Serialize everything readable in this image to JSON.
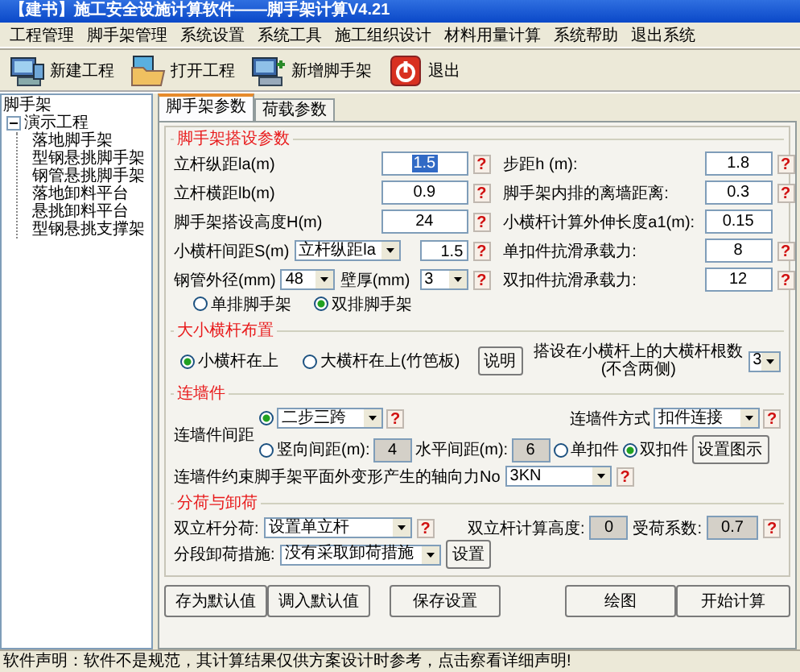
{
  "window": {
    "title": "【建书】施工安全设施计算软件——脚手架计算V4.21"
  },
  "menu": [
    "工程管理",
    "脚手架管理",
    "系统设置",
    "系统工具",
    "施工组织设计",
    "材料用量计算",
    "系统帮助",
    "退出系统"
  ],
  "toolbar": [
    {
      "label": "新建工程",
      "kind": "new"
    },
    {
      "label": "打开工程",
      "kind": "open"
    },
    {
      "label": "新增脚手架",
      "kind": "add"
    },
    {
      "label": "退出",
      "kind": "exit"
    }
  ],
  "tree": {
    "label": "脚手架",
    "children": [
      {
        "label": "演示工程",
        "expanded": true,
        "children": [
          {
            "label": "落地脚手架"
          },
          {
            "label": "型钢悬挑脚手架"
          },
          {
            "label": "钢管悬挑脚手架"
          },
          {
            "label": "落地卸料平台"
          },
          {
            "label": "悬挑卸料平台"
          },
          {
            "label": "型钢悬挑支撑架"
          }
        ]
      }
    ]
  },
  "tabs": [
    {
      "label": "脚手架参数",
      "selected": true
    },
    {
      "label": "荷载参数",
      "selected": false
    }
  ],
  "params": {
    "title": "脚手架搭设参数",
    "left": [
      {
        "label": "立杆纵距la(m)",
        "value": "1.5",
        "focused": true,
        "help": "?"
      },
      {
        "label": "立杆横距lb(m)",
        "value": "0.9",
        "focused": false,
        "help": "?"
      },
      {
        "label": "脚手架搭设高度H(m)",
        "value": "24",
        "focused": false,
        "help": "?"
      }
    ],
    "spacing": {
      "label": "小横杆间距S(m)",
      "select": "立杆纵距la",
      "value": "1.5",
      "help": "?"
    },
    "pipe": {
      "label": "钢管外径(mm)",
      "value": "48",
      "thickness_label": "壁厚(mm)",
      "thickness": "3",
      "help": "?"
    },
    "right": [
      {
        "label": "步距h (m):",
        "value": "1.8",
        "help": "?"
      },
      {
        "label": "脚手架内排的离墙距离:",
        "value": "0.3",
        "help": "?"
      },
      {
        "label": "小横杆计算外伸长度a1(m):",
        "value": "0.15"
      },
      {
        "label": "单扣件抗滑承载力:",
        "value": "8",
        "help": "?"
      },
      {
        "label": "双扣件抗滑承载力:",
        "value": "12",
        "help": "?"
      }
    ],
    "rows_type": [
      {
        "label": "单排脚手架",
        "selected": false
      },
      {
        "label": "双排脚手架",
        "selected": true
      }
    ]
  },
  "layout": {
    "title": "大小横杆布置",
    "options": [
      {
        "label": "小横杆在上",
        "selected": true
      },
      {
        "label": "大横杆在上(竹笆板)",
        "selected": false
      }
    ],
    "note_button": "说明",
    "count_label": "搭设在小横杆上的大横杆根数",
    "count_note": "(不含两侧)",
    "count": "3"
  },
  "wall": {
    "title": "连墙件",
    "label": "连墙件间距",
    "mode_by_steps": {
      "selected": true,
      "value": "二步三跨",
      "help": "?"
    },
    "mode_by_distance": {
      "selected": false,
      "vertical_label": "竖向间距(m):",
      "vertical": {
        "value": "4",
        "disabled": true
      },
      "horizontal_label": "水平间距(m):",
      "horizontal": {
        "value": "6",
        "disabled": true
      }
    },
    "fastener": [
      {
        "label": "单扣件",
        "selected": false
      },
      {
        "label": "双扣件",
        "selected": true
      }
    ],
    "diagram_button": "设置图示",
    "method": {
      "label": "连墙件方式",
      "value": "扣件连接",
      "help": "?"
    },
    "axial": {
      "label": "连墙件约束脚手架平面外变形产生的轴向力No",
      "value": "3KN",
      "help": "?"
    }
  },
  "unload": {
    "title": "分荷与卸荷",
    "double_pole": {
      "label": "双立杆分荷:",
      "value": "设置单立杆",
      "help": "?"
    },
    "calc_height": {
      "label": "双立杆计算高度:",
      "value": "0",
      "disabled": true
    },
    "load_factor": {
      "label": "受荷系数:",
      "value": "0.7",
      "disabled": true,
      "help": "?"
    },
    "measures": {
      "label": "分段卸荷措施:",
      "value": "没有采取卸荷措施",
      "button": "设置"
    }
  },
  "buttons": [
    "存为默认值",
    "调入默认值",
    "保存设置",
    "绘图",
    "开始计算"
  ],
  "status_bar": "软件声明：软件不是规范，其计算结果仅供方案设计时参考，点击察看详细声明!"
}
